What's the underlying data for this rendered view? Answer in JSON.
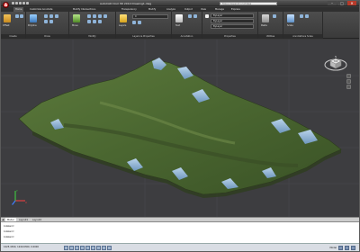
{
  "titlebar": {
    "app_button_label": "A",
    "title": "AutoCAD Civil 3D 2010    Drawing1.dwg",
    "help_placeholder": "Type a keyword or phrase",
    "minimize": "–",
    "maximize": "□",
    "close": "✕"
  },
  "ribbon_tabs": [
    "Home",
    "Customize Annotate",
    "Modify Intersections",
    "Transparency",
    "Modify",
    "Analyze",
    "Output",
    "View",
    "Manage",
    "Express"
  ],
  "ribbon_panels": [
    {
      "label": "Create",
      "tool": "Offset"
    },
    {
      "label": "Draw",
      "tool": "Polyline"
    },
    {
      "label": "Modify",
      "tool": "Move"
    },
    {
      "label": "Layers & Properties",
      "tool": "Layers"
    },
    {
      "label": "Annotation",
      "tool": "Text"
    },
    {
      "label": "Properties",
      "tool": "ByLayer"
    },
    {
      "label": "Utilities",
      "tool": "Paste"
    },
    {
      "label": "Annotations Scale",
      "tool": "Scale"
    }
  ],
  "combos": {
    "layer": "0",
    "color": "ByLayer",
    "linetype": "ByLayer",
    "lineweight": "ByLayer"
  },
  "viewcube": {
    "top_label": "TOP",
    "compass": [
      "N",
      "E",
      "S",
      "W"
    ]
  },
  "ucs": {
    "x": "X",
    "y": "Y",
    "z": "Z"
  },
  "layout_tabs": [
    "Model",
    "Layout1",
    "Layout2"
  ],
  "command_lines": [
    "Command:",
    "Command:",
    "Command:"
  ],
  "status": {
    "coords": "1025.4300, 1240.6300, 0.0000",
    "workspace": "Model"
  },
  "colors": {
    "viewport_bg": "#3d3d40",
    "terrain_green": "#4e6b34",
    "terrain_snow": "#8fb5d8"
  }
}
